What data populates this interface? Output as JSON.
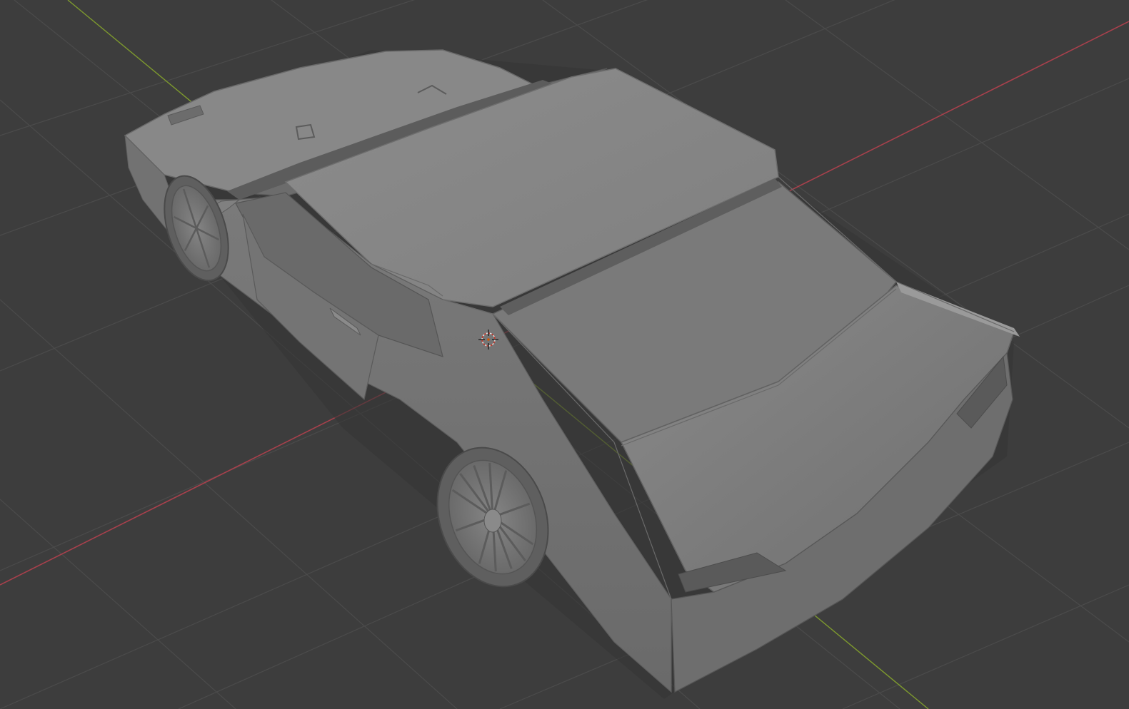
{
  "viewport": {
    "kind": "3d-viewport",
    "background_color": "#3d3d3d",
    "grid_color": "#4a4a4a",
    "axis_x_color": "#a8404c",
    "axis_y_color": "#7e9a2e",
    "model": {
      "name": "car-mesh",
      "shading": "solid-gray",
      "base_color": "#8a8a8a"
    },
    "cursor_icon": "3d-cursor-icon"
  }
}
